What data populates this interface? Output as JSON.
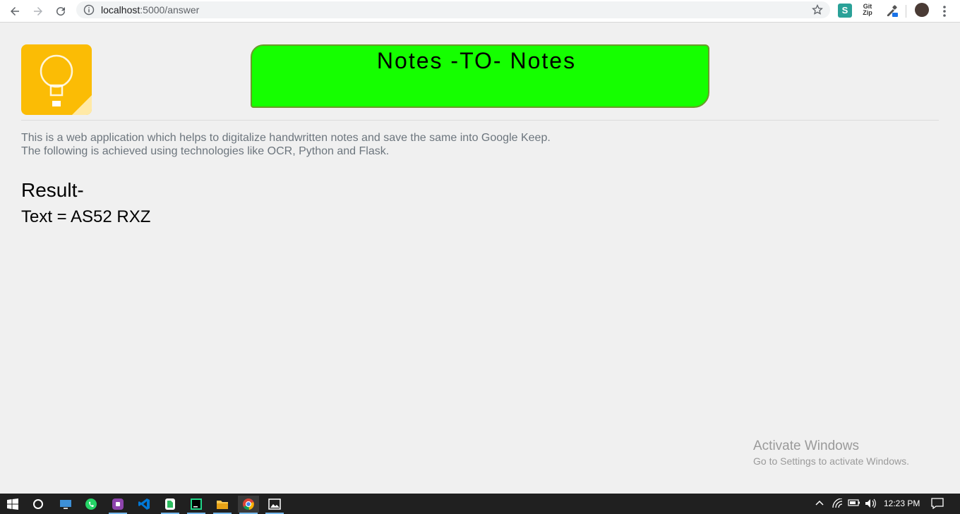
{
  "browser": {
    "url_host": "localhost",
    "url_path": ":5000/answer"
  },
  "header": {
    "title": "Notes -TO- Notes"
  },
  "description": {
    "line1": "This is a web application which helps to digitalize handwritten notes and save the same into Google Keep.",
    "line2": "The following is achieved using technologies like OCR, Python and Flask."
  },
  "result": {
    "heading": "Result-",
    "text": "Text = AS52 RXZ"
  },
  "watermark": {
    "line1": "Activate Windows",
    "line2": "Go to Settings to activate Windows."
  },
  "extensions": {
    "git_zip_top": "Git",
    "git_zip_bottom": "Zip",
    "s_label": "S"
  },
  "taskbar": {
    "time": "12:23 PM"
  },
  "colors": {
    "title_box": "#15ff00",
    "logo": "#fbbc05",
    "description_text": "#6c757d"
  }
}
